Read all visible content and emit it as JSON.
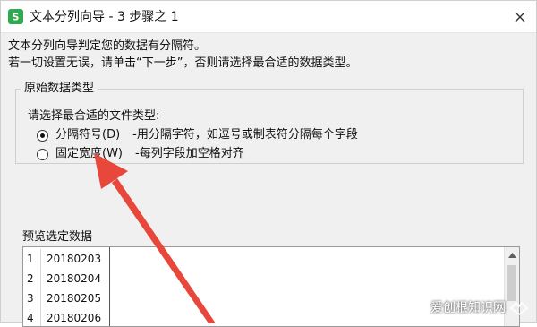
{
  "window": {
    "title": "文本分列向导 - 3 步骤之 1",
    "app_icon_letter": "S",
    "close_icon": "close-icon"
  },
  "description": {
    "line1": "文本分列向导判定您的数据有分隔符。",
    "line2": "若一切设置无误，请单击“下一步”，否则请选择最合适的数据类型。"
  },
  "original_type": {
    "group_title": "原始数据类型",
    "prompt": "请选择最合适的文件类型:",
    "options": [
      {
        "label": "分隔符号(D)",
        "description": "-用分隔字符，如逗号或制表符分隔每个字段",
        "checked": true
      },
      {
        "label": "固定宽度(W)",
        "description": "-每列字段加空格对齐",
        "checked": false
      }
    ]
  },
  "preview": {
    "label": "预览选定数据",
    "rows": [
      {
        "num": "1",
        "value": "20180203"
      },
      {
        "num": "2",
        "value": "20180204"
      },
      {
        "num": "3",
        "value": "20180205"
      },
      {
        "num": "4",
        "value": "20180206"
      }
    ]
  },
  "annotation": {
    "arrow_color": "#e8473c"
  },
  "watermark": {
    "text": "爱创根知识网"
  },
  "colors": {
    "dialog_bg": "#f0f0f0",
    "app_icon_green": "#2fa84f"
  }
}
